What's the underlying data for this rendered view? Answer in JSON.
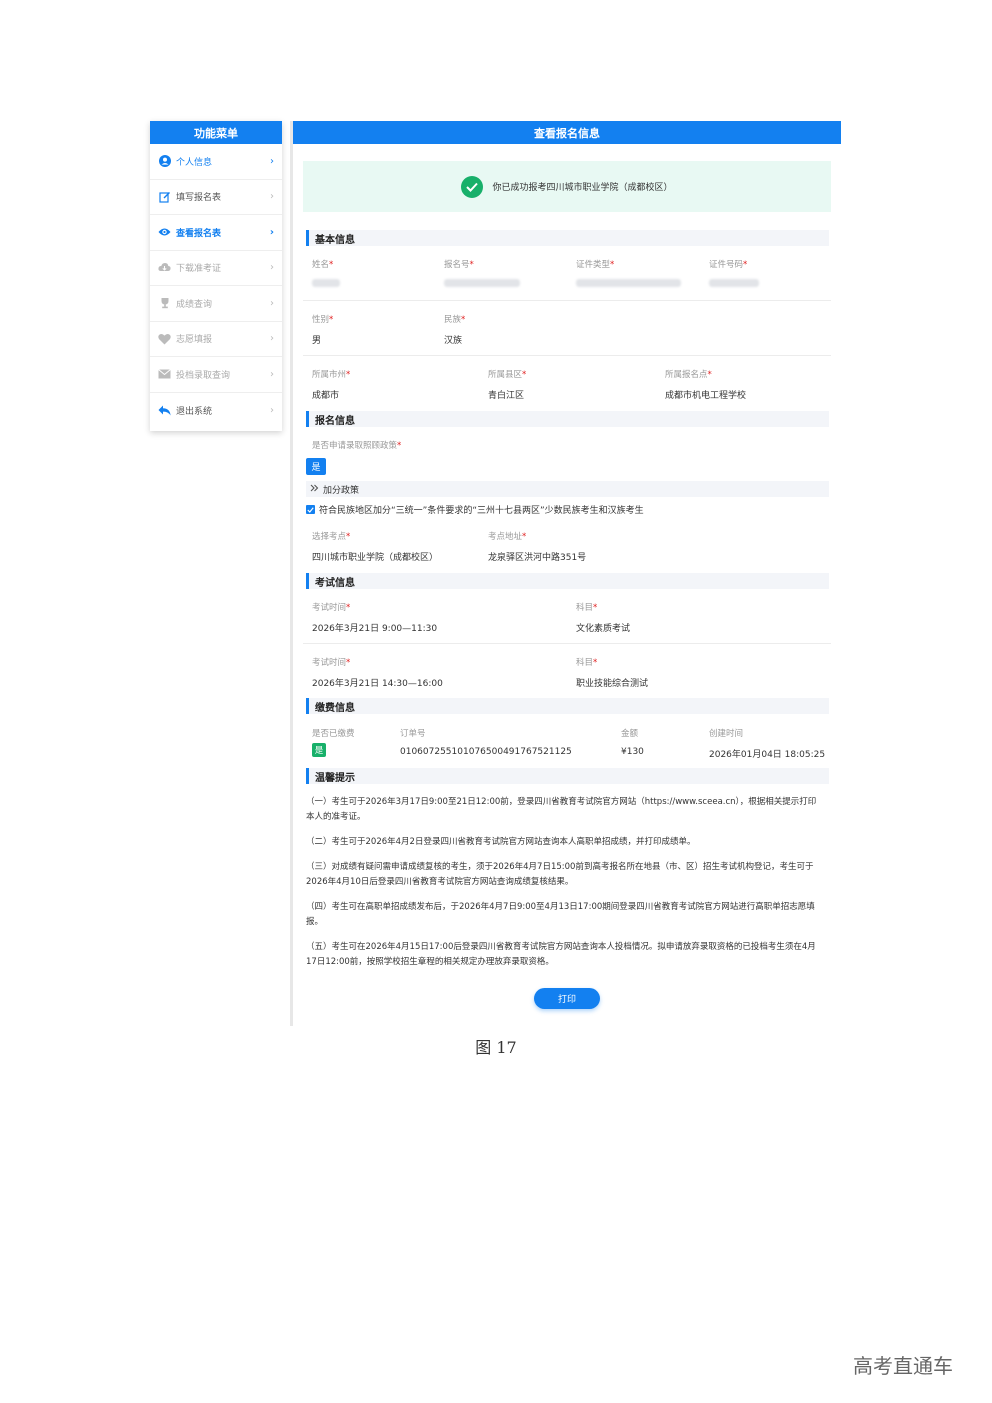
{
  "sidebar": {
    "title": "功能菜单",
    "items": [
      {
        "label": "个人信息",
        "icon": "user-icon"
      },
      {
        "label": "填写报名表",
        "icon": "edit-icon"
      },
      {
        "label": "查看报名表",
        "icon": "eye-icon"
      },
      {
        "label": "下载准考证",
        "icon": "cloud-download-icon"
      },
      {
        "label": "成绩查询",
        "icon": "trophy-icon"
      },
      {
        "label": "志愿填报",
        "icon": "heart-icon"
      },
      {
        "label": "投档录取查询",
        "icon": "mail-icon"
      },
      {
        "label": "退出系统",
        "icon": "reply-icon"
      }
    ],
    "chevron": "›"
  },
  "main": {
    "title": "查看报名信息",
    "success_message": "你已成功报考四川城市职业学院（成都校区）"
  },
  "basic_info": {
    "title": "基本信息",
    "name_label": "姓名",
    "reg_no_label": "报名号",
    "id_type_label": "证件类型",
    "id_no_label": "证件号码",
    "gender_label": "性别",
    "gender": "男",
    "ethnicity_label": "民族",
    "ethnicity": "汉族",
    "city_label": "所属市州",
    "city": "成都市",
    "district_label": "所属县区",
    "district": "青白江区",
    "site_label": "所属报名点",
    "site": "成都市机电工程学校"
  },
  "registration_info": {
    "title": "报名信息",
    "policy_label": "是否申请录取照顾政策",
    "policy_value": "是",
    "bonus_label": "加分政策",
    "checkbox_text": "符合民族地区加分“三统一”条件要求的“三州十七县两区”少数民族考生和汉族考生",
    "exam_site_label": "选择考点",
    "exam_site": "四川城市职业学院（成都校区）",
    "exam_address_label": "考点地址",
    "exam_address": "龙泉驿区洪河中路351号"
  },
  "exam_info": {
    "title": "考试信息",
    "time_label": "考试时间",
    "subject_label": "科目",
    "rows": [
      {
        "time": "2026年3月21日 9:00—11:30",
        "subject": "文化素质考试"
      },
      {
        "time": "2026年3月21日 14:30—16:00",
        "subject": "职业技能综合测试"
      }
    ]
  },
  "payment_info": {
    "title": "缴费信息",
    "paid_label": "是否已缴费",
    "paid": "是",
    "order_label": "订单号",
    "order": "010607255101076500491767521125",
    "amount_label": "金额",
    "amount": "¥130",
    "created_label": "创建时间",
    "created": "2026年01月04日 18:05:25"
  },
  "tips": {
    "title": "温馨提示",
    "items": [
      "（一）考生可于2026年3月17日9:00至21日12:00前，登录四川省教育考试院官方网站（https://www.sceea.cn），根据相关提示打印本人的准考证。",
      "（二）考生可于2026年4月2日登录四川省教育考试院官方网站查询本人高职单招成绩，并打印成绩单。",
      "（三）对成绩有疑问需申请成绩复核的考生，须于2026年4月7日15:00前到高考报名所在地县（市、区）招生考试机构登记，考生可于2026年4月10日后登录四川省教育考试院官方网站查询成绩复核结果。",
      "（四）考生可在高职单招成绩发布后，于2026年4月7日9:00至4月13日17:00期间登录四川省教育考试院官方网站进行高职单招志愿填报。",
      "（五）考生可在2026年4月15日17:00后登录四川省教育考试院官方网站查询本人投档情况。拟申请放弃录取资格的已投档考生须在4月17日12:00前，按照学校招生章程的相关规定办理放弃录取资格。"
    ]
  },
  "print_label": "打印",
  "caption": "图 17",
  "watermark": "高考直通车",
  "required_mark": "*",
  "colors": {
    "primary": "#1380f0",
    "success": "#18b06a",
    "success_bg": "#e8f9f3"
  }
}
